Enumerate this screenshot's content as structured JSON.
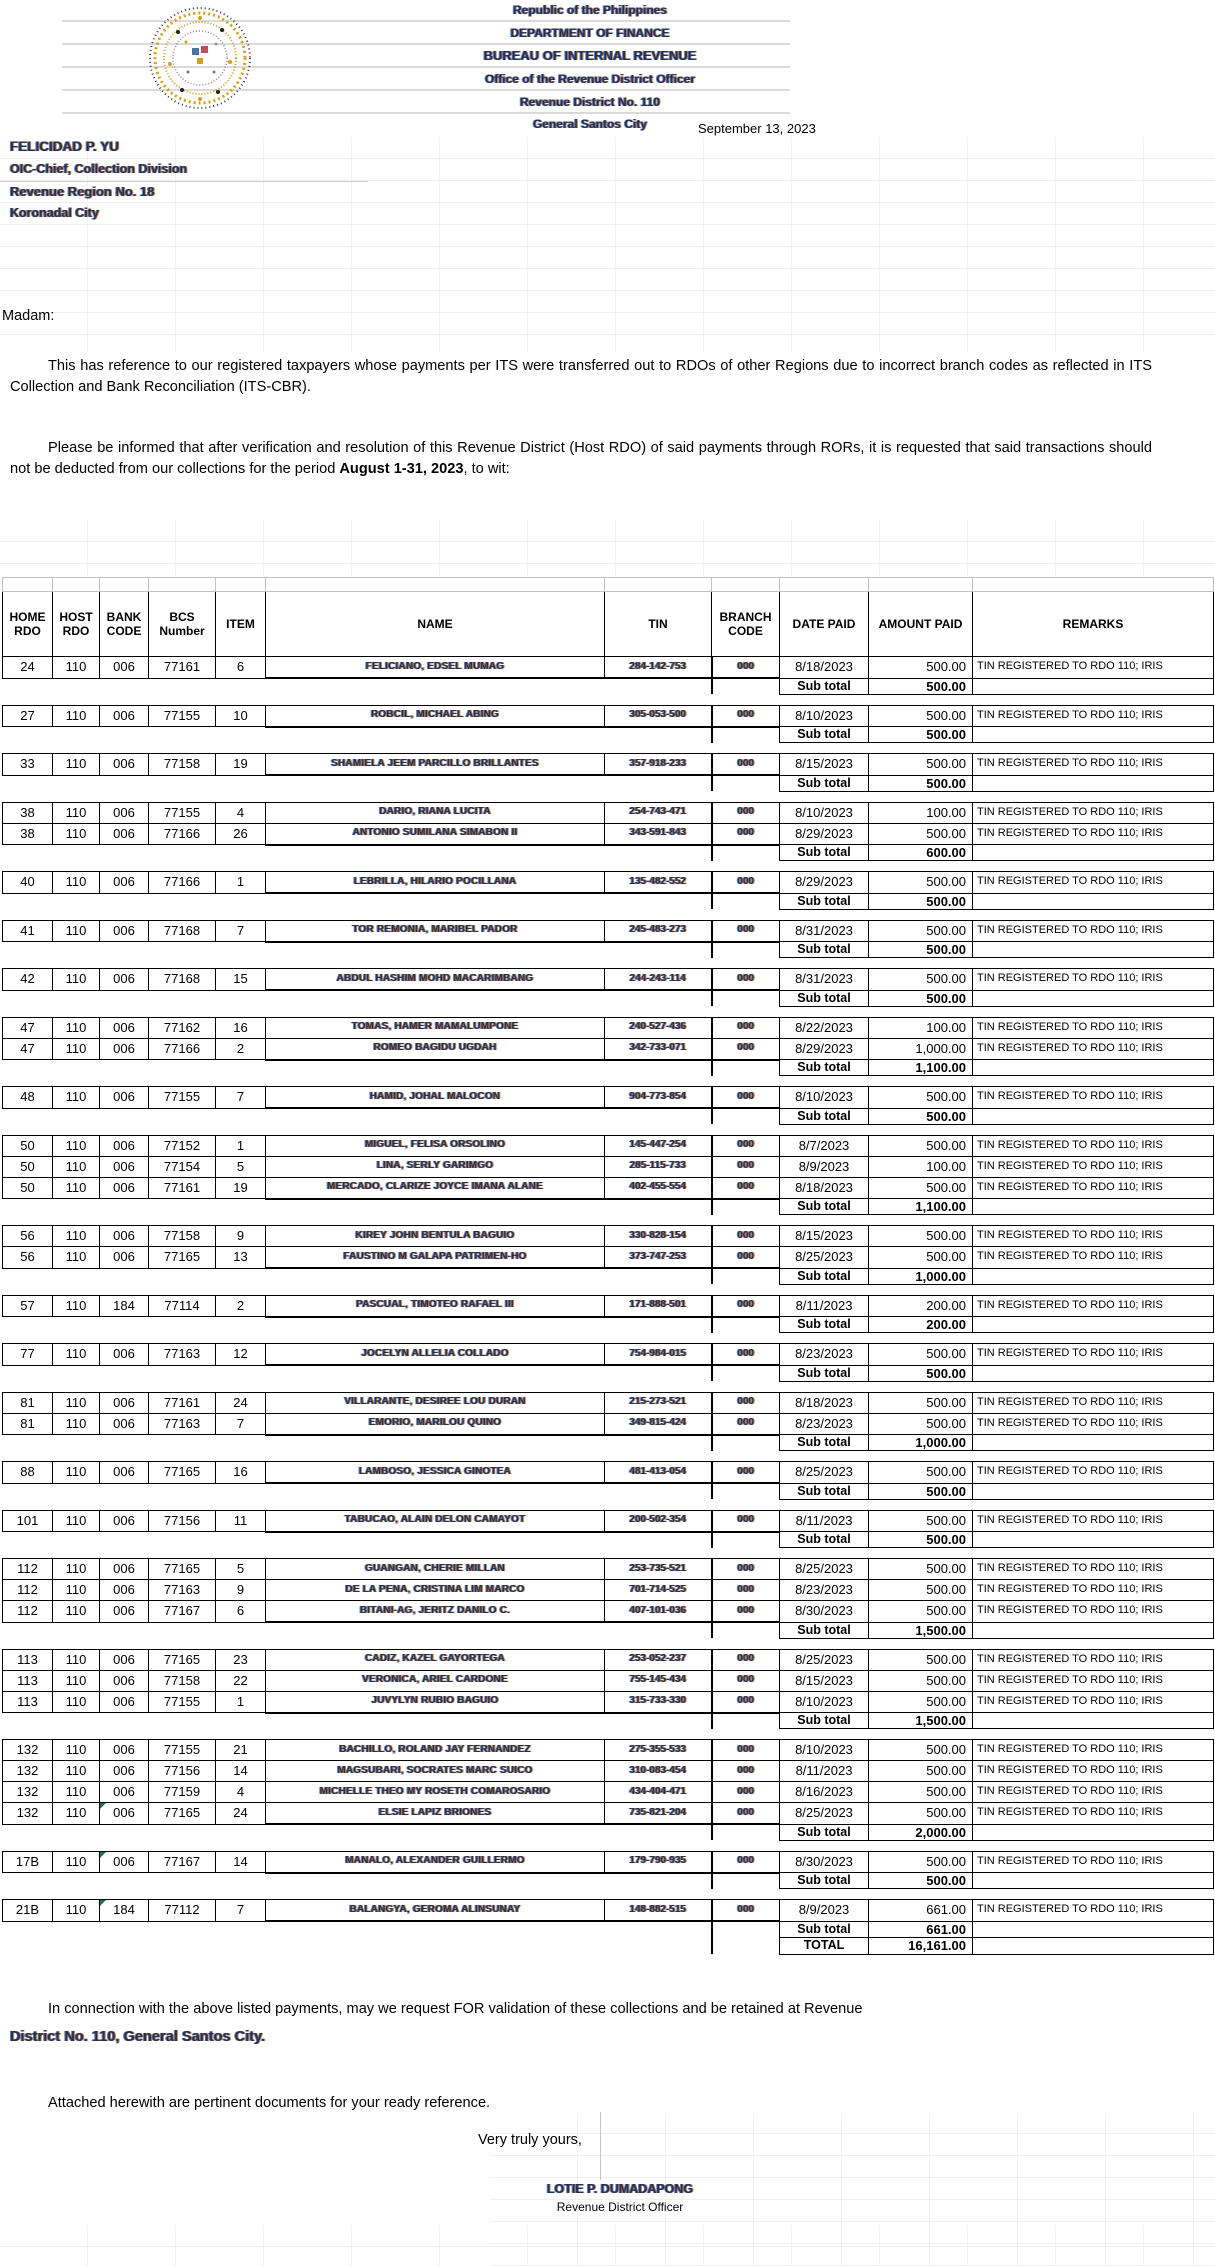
{
  "letterhead": {
    "lines": [
      "Republic of the Philippines",
      "DEPARTMENT OF FINANCE",
      "BUREAU OF INTERNAL REVENUE",
      "Office of the Revenue District Officer",
      "Revenue District No. 110",
      "General Santos City"
    ]
  },
  "date": "September 13, 2023",
  "addressee": {
    "name": "FELICIDAD P. YU",
    "position": "OIC-Chief, Collection Division",
    "office": "Revenue Region No. 18",
    "city": "Koronadal City"
  },
  "salutation": "Madam:",
  "body": {
    "p1": "This has reference to our registered taxpayers whose payments per ITS were transferred  out to RDOs of other Regions due to incorrect branch codes as reflected in ITS  Collection and Bank Reconciliation (ITS-CBR).",
    "p2_before": "Please be informed that after verification and resolution of this Revenue District (Host RDO) of said payments through RORs, it is requested that said transactions should not be deducted from our collections for the period ",
    "p2_bold": "August 1-31, 2023",
    "p2_after": ", to wit:"
  },
  "table": {
    "headers": [
      "HOME RDO",
      "HOST RDO",
      "BANK CODE",
      "BCS Number",
      "ITEM",
      "NAME",
      "TIN",
      "BRANCH CODE",
      "DATE PAID",
      "AMOUNT PAID",
      "REMARKS"
    ],
    "subtotal_label": "Sub total",
    "total_label": "TOTAL",
    "total_amount": "16,161.00",
    "default_remark": "TIN REGISTERED TO RDO 110; IRIS",
    "groups": [
      {
        "rows": [
          {
            "home": "24",
            "host": "110",
            "bank": "006",
            "bcs": "77161",
            "item": "6",
            "name": "FELICIANO, EDSEL MUMAG",
            "tin": "284-142-753",
            "branch": "000",
            "date": "8/18/2023",
            "amount": "500.00"
          }
        ],
        "subtotal": "500.00"
      },
      {
        "rows": [
          {
            "home": "27",
            "host": "110",
            "bank": "006",
            "bcs": "77155",
            "item": "10",
            "name": "ROBCIL, MICHAEL ABING",
            "tin": "305-053-500",
            "branch": "000",
            "date": "8/10/2023",
            "amount": "500.00"
          }
        ],
        "subtotal": "500.00"
      },
      {
        "rows": [
          {
            "home": "33",
            "host": "110",
            "bank": "006",
            "bcs": "77158",
            "item": "19",
            "name": "SHAMIELA JEEM PARCILLO BRILLANTES",
            "tin": "357-918-233",
            "branch": "000",
            "date": "8/15/2023",
            "amount": "500.00"
          }
        ],
        "subtotal": "500.00"
      },
      {
        "rows": [
          {
            "home": "38",
            "host": "110",
            "bank": "006",
            "bcs": "77155",
            "item": "4",
            "name": "DARIO, RIANA LUCITA",
            "tin": "254-743-471",
            "branch": "000",
            "date": "8/10/2023",
            "amount": "100.00"
          },
          {
            "home": "38",
            "host": "110",
            "bank": "006",
            "bcs": "77166",
            "item": "26",
            "name": "ANTONIO SUMILANA SIMABON II",
            "tin": "343-591-843",
            "branch": "000",
            "date": "8/29/2023",
            "amount": "500.00"
          }
        ],
        "subtotal": "600.00"
      },
      {
        "rows": [
          {
            "home": "40",
            "host": "110",
            "bank": "006",
            "bcs": "77166",
            "item": "1",
            "name": "LEBRILLA, HILARIO POCILLANA",
            "tin": "135-482-552",
            "branch": "000",
            "date": "8/29/2023",
            "amount": "500.00"
          }
        ],
        "subtotal": "500.00"
      },
      {
        "rows": [
          {
            "home": "41",
            "host": "110",
            "bank": "006",
            "bcs": "77168",
            "item": "7",
            "name": "TOR REMONIA, MARIBEL PADOR",
            "tin": "245-483-273",
            "branch": "000",
            "date": "8/31/2023",
            "amount": "500.00"
          }
        ],
        "subtotal": "500.00"
      },
      {
        "rows": [
          {
            "home": "42",
            "host": "110",
            "bank": "006",
            "bcs": "77168",
            "item": "15",
            "name": "ABDUL HASHIM MOHD MACARIMBANG",
            "tin": "244-243-114",
            "branch": "000",
            "date": "8/31/2023",
            "amount": "500.00"
          }
        ],
        "subtotal": "500.00"
      },
      {
        "rows": [
          {
            "home": "47",
            "host": "110",
            "bank": "006",
            "bcs": "77162",
            "item": "16",
            "name": "TOMAS, HAMER MAMALUMPONE",
            "tin": "240-527-436",
            "branch": "000",
            "date": "8/22/2023",
            "amount": "100.00"
          },
          {
            "home": "47",
            "host": "110",
            "bank": "006",
            "bcs": "77166",
            "item": "2",
            "name": "ROMEO BAGIDU UGDAH",
            "tin": "342-733-071",
            "branch": "000",
            "date": "8/29/2023",
            "amount": "1,000.00"
          }
        ],
        "subtotal": "1,100.00"
      },
      {
        "rows": [
          {
            "home": "48",
            "host": "110",
            "bank": "006",
            "bcs": "77155",
            "item": "7",
            "name": "HAMID, JOHAL MALOCON",
            "tin": "904-773-854",
            "branch": "000",
            "date": "8/10/2023",
            "amount": "500.00"
          }
        ],
        "subtotal": "500.00"
      },
      {
        "rows": [
          {
            "home": "50",
            "host": "110",
            "bank": "006",
            "bcs": "77152",
            "item": "1",
            "name": "MIGUEL, FELISA ORSOLINO",
            "tin": "145-447-254",
            "branch": "000",
            "date": "8/7/2023",
            "amount": "500.00"
          },
          {
            "home": "50",
            "host": "110",
            "bank": "006",
            "bcs": "77154",
            "item": "5",
            "name": "LINA, SERLY GARIMGO",
            "tin": "285-115-733",
            "branch": "000",
            "date": "8/9/2023",
            "amount": "100.00"
          },
          {
            "home": "50",
            "host": "110",
            "bank": "006",
            "bcs": "77161",
            "item": "19",
            "name": "MERCADO, CLARIZE JOYCE IMANA ALANE",
            "tin": "402-455-554",
            "branch": "000",
            "date": "8/18/2023",
            "amount": "500.00"
          }
        ],
        "subtotal": "1,100.00"
      },
      {
        "rows": [
          {
            "home": "56",
            "host": "110",
            "bank": "006",
            "bcs": "77158",
            "item": "9",
            "name": "KIREY JOHN BENTULA BAGUIO",
            "tin": "330-828-154",
            "branch": "000",
            "date": "8/15/2023",
            "amount": "500.00"
          },
          {
            "home": "56",
            "host": "110",
            "bank": "006",
            "bcs": "77165",
            "item": "13",
            "name": "FAUSTINO M GALAPA PATRIMEN-HO",
            "tin": "373-747-253",
            "branch": "000",
            "date": "8/25/2023",
            "amount": "500.00"
          }
        ],
        "subtotal": "1,000.00"
      },
      {
        "rows": [
          {
            "home": "57",
            "host": "110",
            "bank": "184",
            "bcs": "77114",
            "item": "2",
            "name": "PASCUAL, TIMOTEO RAFAEL III",
            "tin": "171-888-501",
            "branch": "000",
            "date": "8/11/2023",
            "amount": "200.00"
          }
        ],
        "subtotal": "200.00"
      },
      {
        "rows": [
          {
            "home": "77",
            "host": "110",
            "bank": "006",
            "bcs": "77163",
            "item": "12",
            "name": "JOCELYN ALLELIA COLLADO",
            "tin": "754-984-015",
            "branch": "000",
            "date": "8/23/2023",
            "amount": "500.00"
          }
        ],
        "subtotal": "500.00"
      },
      {
        "rows": [
          {
            "home": "81",
            "host": "110",
            "bank": "006",
            "bcs": "77161",
            "item": "24",
            "name": "VILLARANTE, DESIREE LOU DURAN",
            "tin": "215-273-521",
            "branch": "000",
            "date": "8/18/2023",
            "amount": "500.00"
          },
          {
            "home": "81",
            "host": "110",
            "bank": "006",
            "bcs": "77163",
            "item": "7",
            "name": "EMORIO, MARILOU QUINO",
            "tin": "349-815-424",
            "branch": "000",
            "date": "8/23/2023",
            "amount": "500.00"
          }
        ],
        "subtotal": "1,000.00"
      },
      {
        "rows": [
          {
            "home": "88",
            "host": "110",
            "bank": "006",
            "bcs": "77165",
            "item": "16",
            "name": "LAMBOSO, JESSICA GINOTEA",
            "tin": "481-413-054",
            "branch": "000",
            "date": "8/25/2023",
            "amount": "500.00"
          }
        ],
        "subtotal": "500.00"
      },
      {
        "rows": [
          {
            "home": "101",
            "host": "110",
            "bank": "006",
            "bcs": "77156",
            "item": "11",
            "name": "TABUCAO, ALAIN DELON CAMAYOT",
            "tin": "200-502-354",
            "branch": "000",
            "date": "8/11/2023",
            "amount": "500.00"
          }
        ],
        "subtotal": "500.00"
      },
      {
        "rows": [
          {
            "home": "112",
            "host": "110",
            "bank": "006",
            "bcs": "77165",
            "item": "5",
            "name": "GUANGAN, CHERIE MILLAN",
            "tin": "253-735-521",
            "branch": "000",
            "date": "8/25/2023",
            "amount": "500.00"
          },
          {
            "home": "112",
            "host": "110",
            "bank": "006",
            "bcs": "77163",
            "item": "9",
            "name": "DE LA PENA, CRISTINA LIM MARCO",
            "tin": "701-714-525",
            "branch": "000",
            "date": "8/23/2023",
            "amount": "500.00"
          },
          {
            "home": "112",
            "host": "110",
            "bank": "006",
            "bcs": "77167",
            "item": "6",
            "name": "BITANI-AG, JERITZ DANILO C.",
            "tin": "407-101-036",
            "branch": "000",
            "date": "8/30/2023",
            "amount": "500.00"
          }
        ],
        "subtotal": "1,500.00"
      },
      {
        "rows": [
          {
            "home": "113",
            "host": "110",
            "bank": "006",
            "bcs": "77165",
            "item": "23",
            "name": "CADIZ, KAZEL GAYORTEGA",
            "tin": "253-052-237",
            "branch": "000",
            "date": "8/25/2023",
            "amount": "500.00"
          },
          {
            "home": "113",
            "host": "110",
            "bank": "006",
            "bcs": "77158",
            "item": "22",
            "name": "VERONICA, ARIEL CARDONE",
            "tin": "755-145-434",
            "branch": "000",
            "date": "8/15/2023",
            "amount": "500.00"
          },
          {
            "home": "113",
            "host": "110",
            "bank": "006",
            "bcs": "77155",
            "item": "1",
            "name": "JUVYLYN RUBIO BAGUIO",
            "tin": "315-733-330",
            "branch": "000",
            "date": "8/10/2023",
            "amount": "500.00"
          }
        ],
        "subtotal": "1,500.00"
      },
      {
        "rows": [
          {
            "home": "132",
            "host": "110",
            "bank": "006",
            "bcs": "77155",
            "item": "21",
            "name": "BACHILLO, ROLAND JAY FERNANDEZ",
            "tin": "275-355-533",
            "branch": "000",
            "date": "8/10/2023",
            "amount": "500.00"
          },
          {
            "home": "132",
            "host": "110",
            "bank": "006",
            "bcs": "77156",
            "item": "14",
            "name": "MAGSUBARI, SOCRATES MARC SUICO",
            "tin": "310-083-454",
            "branch": "000",
            "date": "8/11/2023",
            "amount": "500.00"
          },
          {
            "home": "132",
            "host": "110",
            "bank": "006",
            "bcs": "77159",
            "item": "4",
            "name": "MICHELLE THEO MY ROSETH COMAROSARIO",
            "tin": "434-404-471",
            "branch": "000",
            "date": "8/16/2023",
            "amount": "500.00"
          },
          {
            "home": "132",
            "host": "110",
            "bank": "006",
            "bcs": "77165",
            "item": "24",
            "name": "ELSIE LAPIZ BRIONES",
            "tin": "735-821-204",
            "branch": "000",
            "date": "8/25/2023",
            "amount": "500.00",
            "flag": true
          }
        ],
        "subtotal": "2,000.00"
      },
      {
        "rows": [
          {
            "home": "17B",
            "host": "110",
            "bank": "006",
            "bcs": "77167",
            "item": "14",
            "name": "MANALO, ALEXANDER GUILLERMO",
            "tin": "179-790-935",
            "branch": "000",
            "date": "8/30/2023",
            "amount": "500.00",
            "flag": true
          }
        ],
        "subtotal": "500.00"
      },
      {
        "rows": [
          {
            "home": "21B",
            "host": "110",
            "bank": "184",
            "bcs": "77112",
            "item": "7",
            "name": "BALANGYA, GEROMA ALINSUNAY",
            "tin": "148-882-515",
            "branch": "000",
            "date": "8/9/2023",
            "amount": "661.00",
            "flag": true
          }
        ],
        "subtotal": "661.00"
      }
    ]
  },
  "closing": {
    "line1": "In connection with the above listed payments, may we request FOR validation of these collections and  be retained at Revenue",
    "line2": "District No. 110, General Santos City.",
    "attached": "Attached herewith are pertinent documents for your ready reference.",
    "signoff": "Very truly yours,"
  },
  "signature": {
    "name": "LOTIE P. DUMADAPONG",
    "title": "Revenue District Officer"
  }
}
